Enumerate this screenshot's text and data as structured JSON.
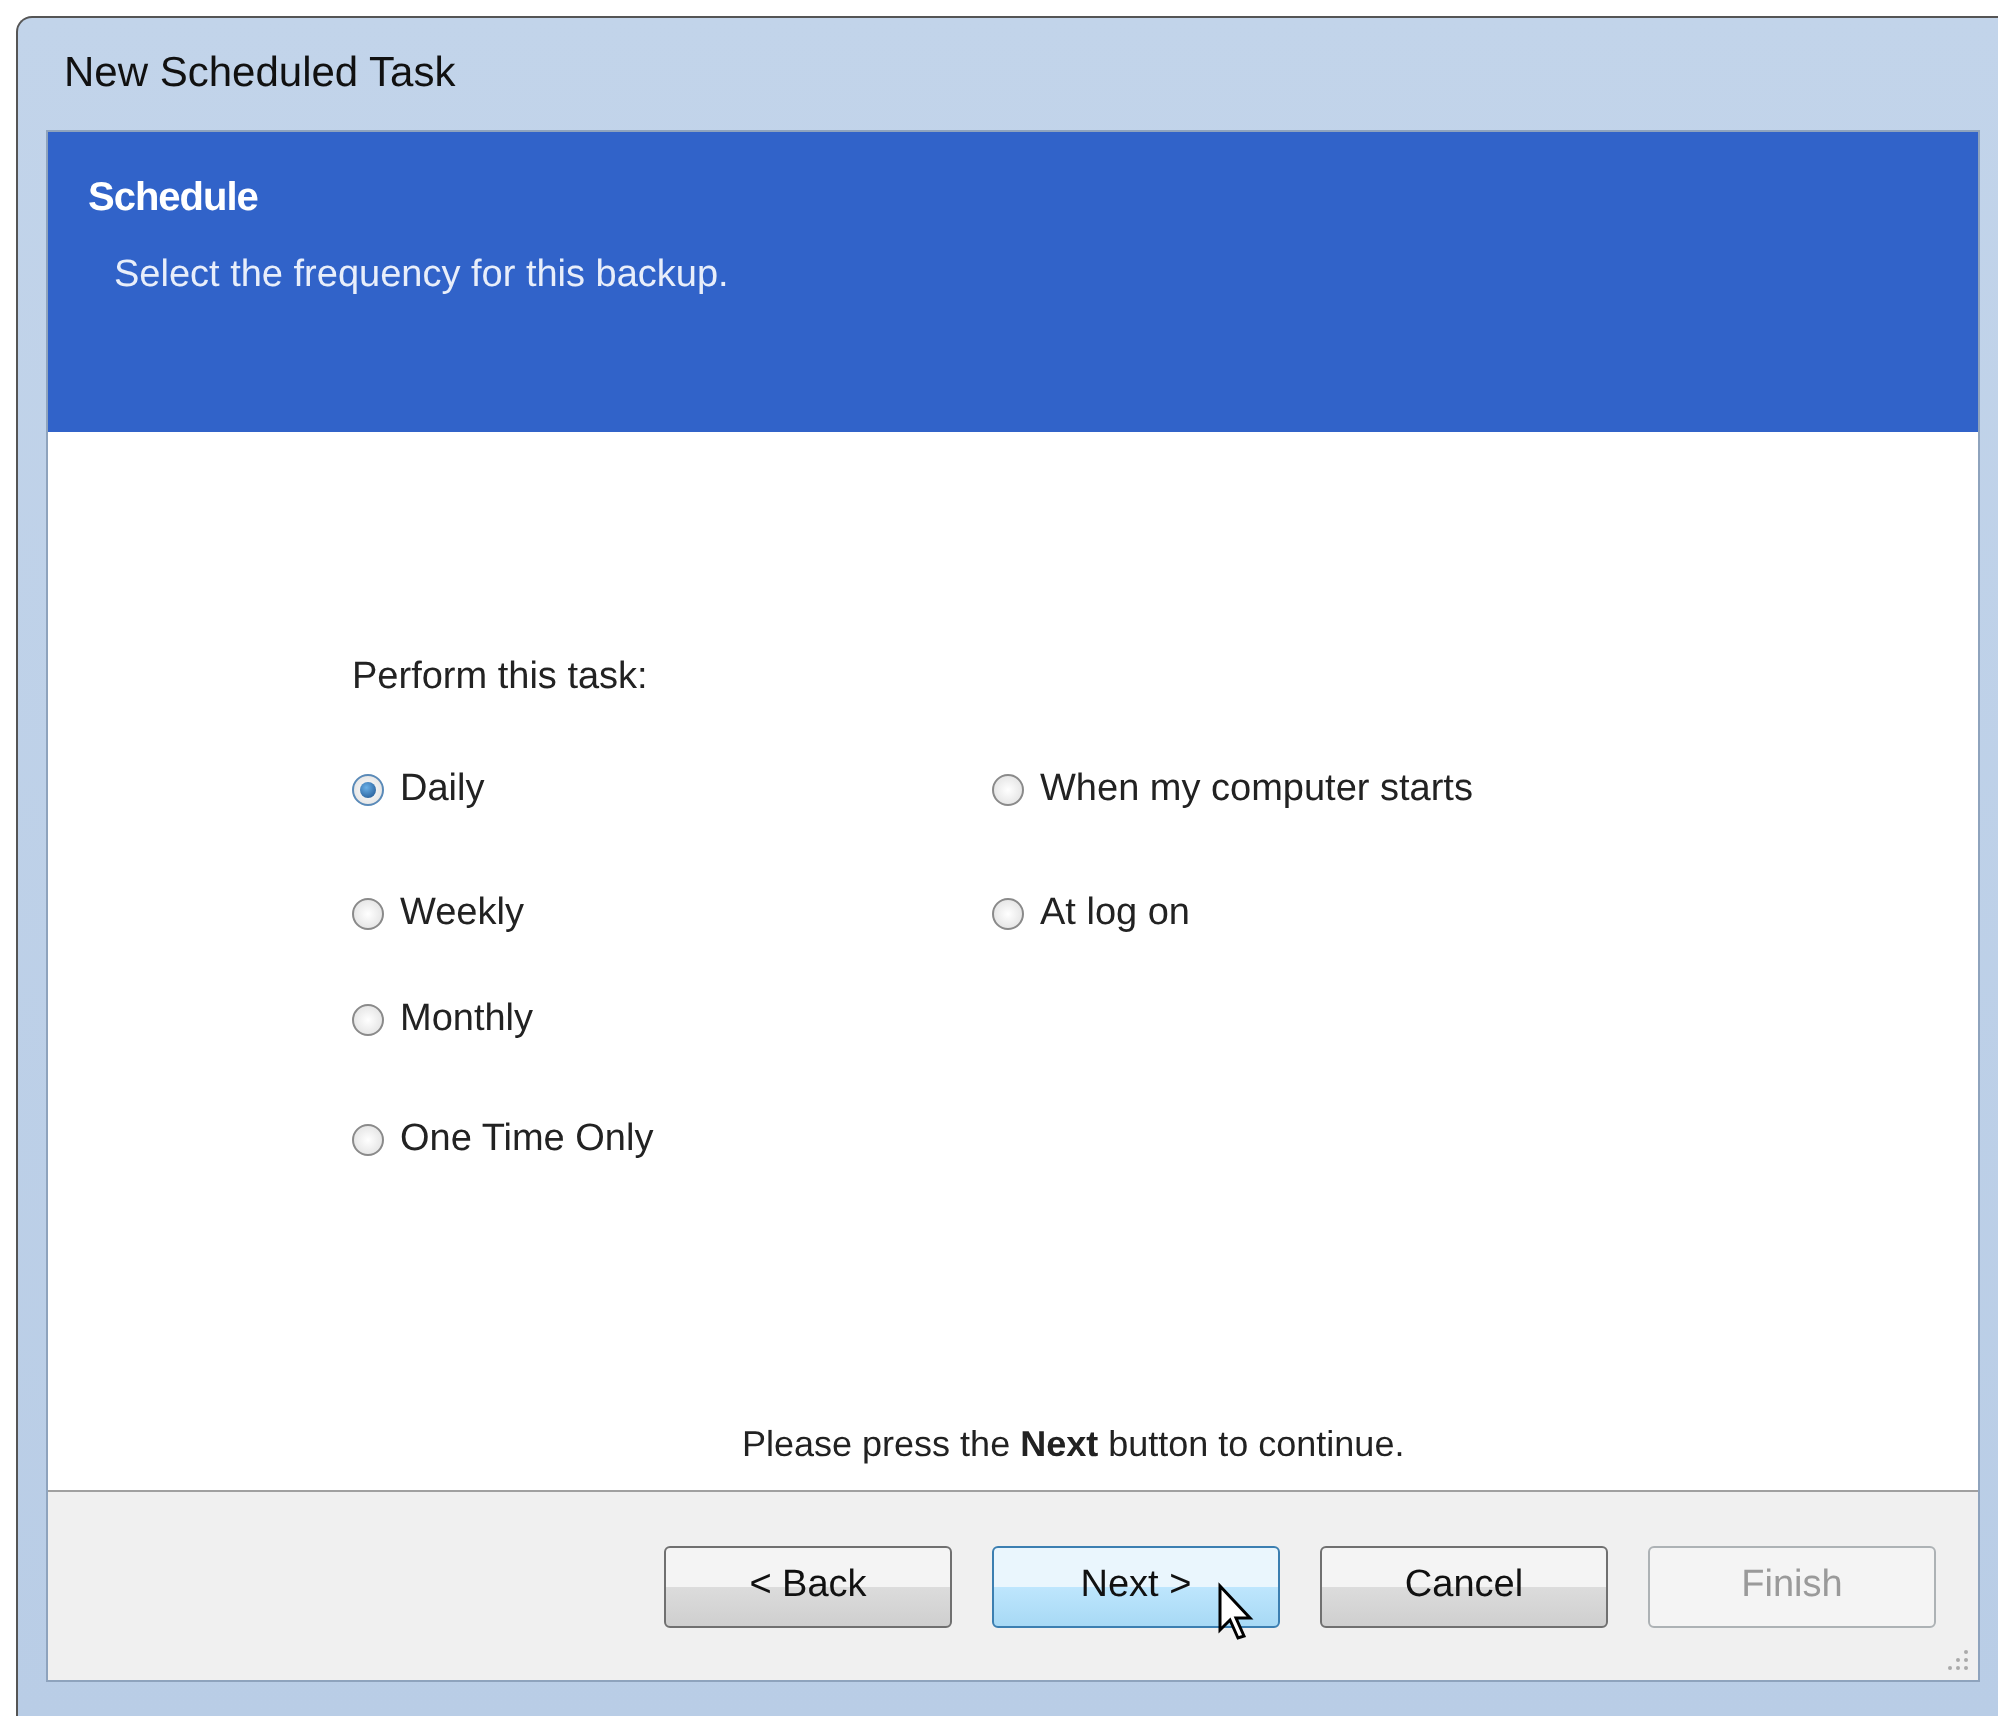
{
  "window": {
    "title": "New Scheduled Task"
  },
  "header": {
    "title": "Schedule",
    "subtitle": "Select the frequency for this backup."
  },
  "prompt": "Perform this task:",
  "columns": [
    [
      {
        "label": "Daily",
        "selected": true
      },
      {
        "label": "Weekly",
        "selected": false
      },
      {
        "label": "Monthly",
        "selected": false
      },
      {
        "label": "One Time Only",
        "selected": false
      }
    ],
    [
      {
        "label": "When my computer starts",
        "selected": false
      },
      {
        "label": "At log on",
        "selected": false
      }
    ]
  ],
  "message": "Please press the **Next** button to continue.",
  "buttons": [
    {
      "label": "< Back",
      "hovered": false,
      "disabled": false
    },
    {
      "label": "Next >",
      "hovered": true,
      "disabled": false
    },
    {
      "label": "Cancel",
      "hovered": false,
      "disabled": false
    },
    {
      "label": "Finish",
      "hovered": false,
      "disabled": true
    }
  ]
}
